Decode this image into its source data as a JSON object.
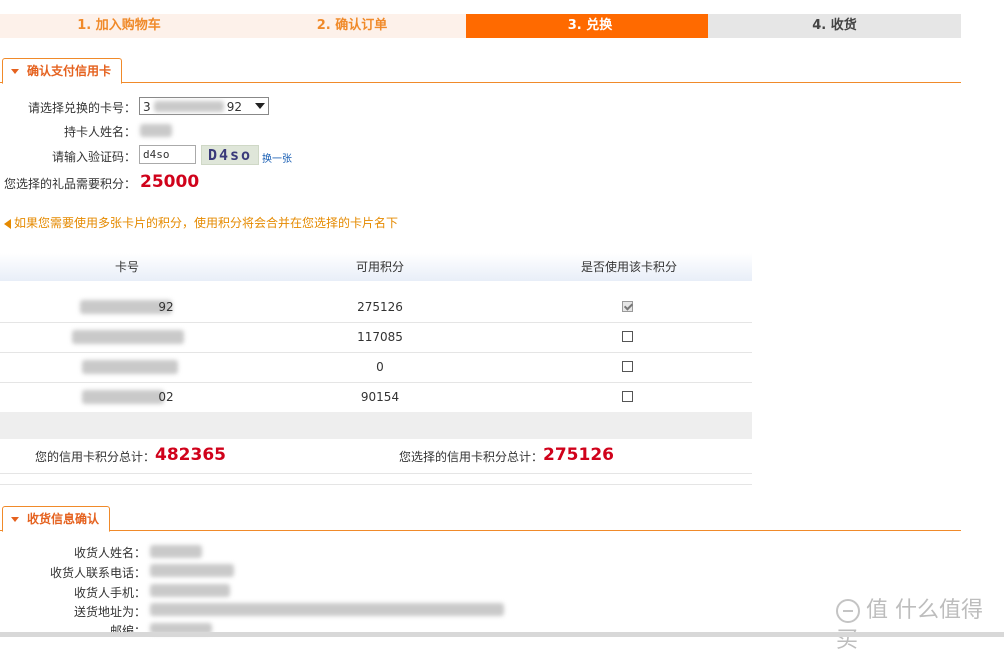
{
  "steps": [
    "1. 加入购物车",
    "2. 确认订单",
    "3. 兑换",
    "4. 收货"
  ],
  "card_section": {
    "title": "确认支付信用卡",
    "select_label": "请选择兑换的卡号：",
    "select_prefix": "3",
    "select_suffix": "92",
    "holder_label": "持卡人姓名：",
    "captcha_label": "请输入验证码：",
    "captcha_input": "d4so",
    "captcha_image": "D4so",
    "captcha_refresh": "换一张",
    "points_label": "您选择的礼品需要积分：",
    "points_value": "25000",
    "notice": "如果您需要使用多张卡片的积分，使用积分将会合并在您选择的卡片名下"
  },
  "table": {
    "headers": [
      "卡号",
      "可用积分",
      "是否使用该卡积分"
    ],
    "rows": [
      {
        "card_suffix": "92",
        "points": "275126",
        "checked": true
      },
      {
        "card_suffix": "",
        "points": "117085",
        "checked": false
      },
      {
        "card_suffix": "",
        "points": "0",
        "checked": false
      },
      {
        "card_suffix": "02",
        "points": "90154",
        "checked": false
      }
    ],
    "total_label": "您的信用卡积分总计：",
    "total_value": "482365",
    "selected_label": "您选择的信用卡积分总计：",
    "selected_value": "275126"
  },
  "shipping_section": {
    "title": "收货信息确认",
    "labels": [
      "收货人姓名：",
      "收货人联系电话：",
      "收货人手机：",
      "送货地址为：",
      "邮编："
    ]
  },
  "watermark": "值 什么值得买",
  "colors": {
    "accent": "#ff6a00",
    "value_red": "#d0021b",
    "notice": "#e58a00"
  }
}
